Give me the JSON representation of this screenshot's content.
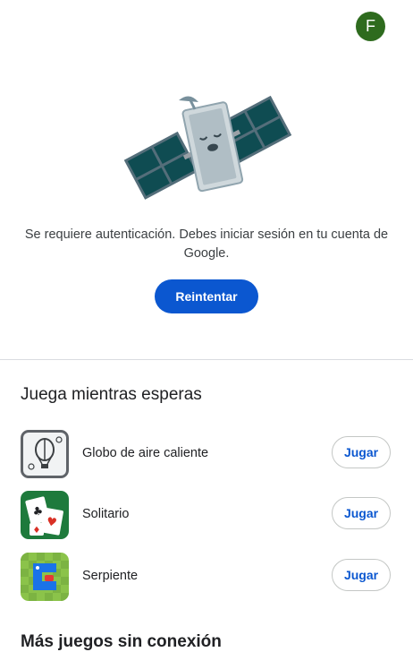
{
  "header": {
    "avatar_initial": "F",
    "avatar_color": "#2e6b1e"
  },
  "illustration": {
    "icon": "sleeping-satellite-icon"
  },
  "error": {
    "message": "Se requiere autenticación. Debes iniciar sesión en tu cuenta de Google.",
    "retry_label": "Reintentar"
  },
  "games_section": {
    "title": "Juega mientras esperas",
    "games": [
      {
        "name": "Globo de aire caliente",
        "icon": "hot-air-balloon-icon",
        "play_label": "Jugar"
      },
      {
        "name": "Solitario",
        "icon": "solitaire-cards-icon",
        "play_label": "Jugar"
      },
      {
        "name": "Serpiente",
        "icon": "snake-game-icon",
        "play_label": "Jugar"
      }
    ]
  },
  "more_section": {
    "title": "Más juegos sin conexión"
  },
  "colors": {
    "accent": "#0b57d0",
    "divider": "#dadce0"
  }
}
